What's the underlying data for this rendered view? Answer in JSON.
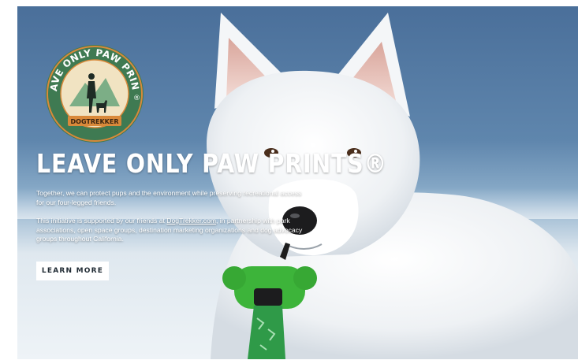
{
  "hero": {
    "logo": {
      "ring_text": "LEAVE ONLY PAW PRINTS",
      "mark": "®",
      "banner_text": "DOGTREKKER",
      "icon": "hiker-with-dog-icon"
    },
    "headline": "LEAVE ONLY PAW PRINTS®",
    "paragraph1": "Together, we can protect pups and the environment while preserving recreational access for our four-legged friends.",
    "paragraph2": {
      "before": "This initiative is supported by our friends at ",
      "link": "DogTrekker.com",
      "after": ", in partnership with park associations, open space groups, destination marketing organizations and dog advocacy groups throughout California."
    },
    "cta_label": "LEARN MORE",
    "colors": {
      "sky": "#5f86ad",
      "logo_green": "#3f7a52",
      "logo_cream": "#f1e3c2",
      "logo_orange": "#d9893a",
      "poop_bag_dispenser": "#3db43a",
      "button_bg": "#ffffff"
    }
  }
}
